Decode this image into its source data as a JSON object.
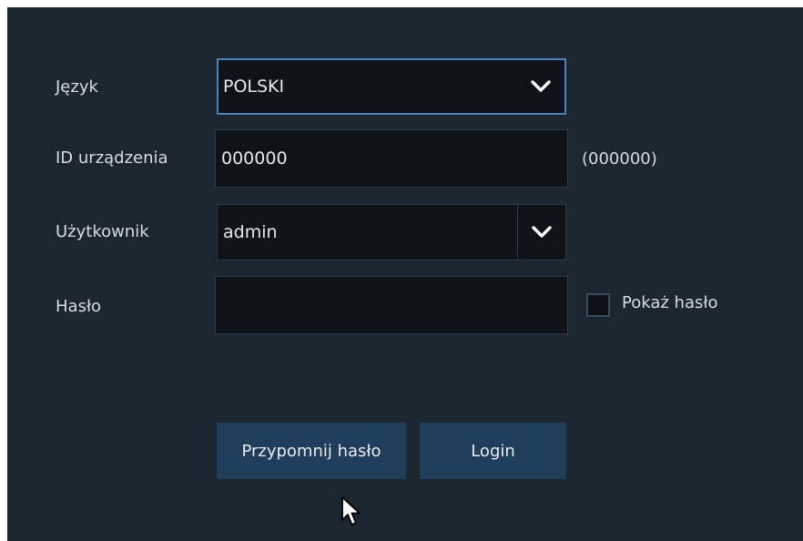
{
  "form": {
    "language": {
      "label": "Język",
      "value": "POLSKI"
    },
    "device_id": {
      "label": "ID urządzenia",
      "value": "000000",
      "hint": "(000000)"
    },
    "user": {
      "label": "Użytkownik",
      "value": "admin"
    },
    "password": {
      "label": "Hasło",
      "value": "",
      "show_password_label": "Pokaż hasło",
      "show_password_checked": false
    }
  },
  "buttons": {
    "remind_label": "Przypomnij hasło",
    "login_label": "Login"
  },
  "icons": {
    "dropdown": "chevron-down-icon",
    "cursor": "mouse-pointer-icon"
  },
  "colors": {
    "background": "#1b2631",
    "field_background": "#0f1217",
    "focus_border": "#4f82b8",
    "button_background": "#1f3e5a"
  }
}
